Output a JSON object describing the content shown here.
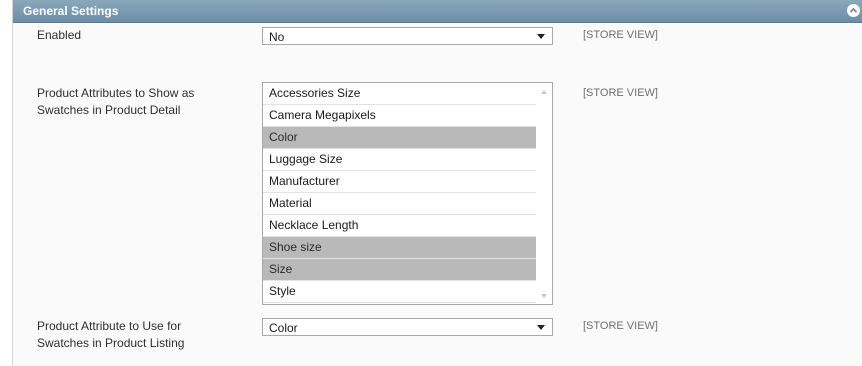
{
  "section": {
    "title": "General Settings",
    "collapse_icon": "collapse-icon"
  },
  "fields": {
    "enabled": {
      "label": "Enabled",
      "value": "No",
      "scope": "[STORE VIEW]"
    },
    "detail_swatches": {
      "label_line1": "Product Attributes to Show as",
      "label_line2": "Swatches in Product Detail",
      "scope": "[STORE VIEW]",
      "options": [
        {
          "label": "Accessories Size",
          "selected": false
        },
        {
          "label": "Camera Megapixels",
          "selected": false
        },
        {
          "label": "Color",
          "selected": true
        },
        {
          "label": "Luggage Size",
          "selected": false
        },
        {
          "label": "Manufacturer",
          "selected": false
        },
        {
          "label": "Material",
          "selected": false
        },
        {
          "label": "Necklace Length",
          "selected": false
        },
        {
          "label": "Shoe size",
          "selected": true
        },
        {
          "label": "Size",
          "selected": true
        },
        {
          "label": "Style",
          "selected": false
        }
      ]
    },
    "listing_swatch": {
      "label_line1": "Product Attribute to Use for",
      "label_line2": "Swatches in Product Listing",
      "value": "Color",
      "scope": "[STORE VIEW]"
    }
  },
  "colors": {
    "header": "#7a9bb2",
    "selected_option": "#b9b9b9"
  }
}
